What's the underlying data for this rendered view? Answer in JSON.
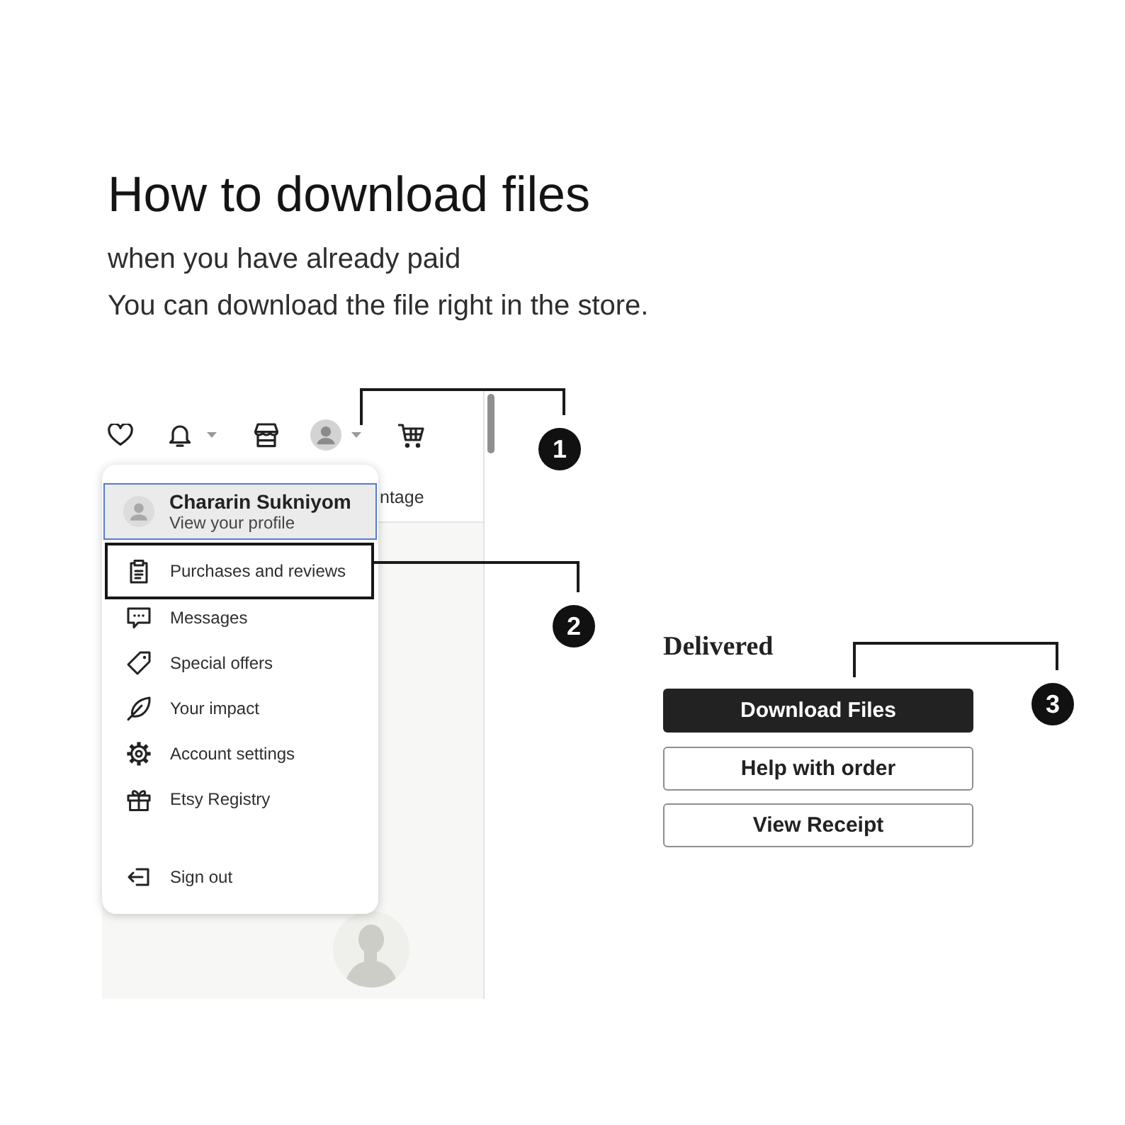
{
  "heading": {
    "title": "How to download files",
    "lines": [
      "when you have already paid",
      "You can download the file right in the store."
    ]
  },
  "store_screenshot": {
    "tab_label": "ntage",
    "account_menu": {
      "sections": [
        {
          "items": [
            {
              "kind": "profile",
              "label": "Chararin Sukniyom",
              "sublabel": "View your profile",
              "selected": true,
              "highlighted": false
            },
            {
              "kind": "link",
              "label": "Purchases and reviews",
              "selected": false,
              "highlighted": true
            },
            {
              "kind": "link",
              "label": "Messages",
              "selected": false,
              "highlighted": false
            },
            {
              "kind": "link",
              "label": "Special offers",
              "selected": false,
              "highlighted": false
            },
            {
              "kind": "link",
              "label": "Your impact",
              "selected": false,
              "highlighted": false
            },
            {
              "kind": "link",
              "label": "Account settings",
              "selected": false,
              "highlighted": false
            },
            {
              "kind": "link",
              "label": "Etsy Registry",
              "selected": false,
              "highlighted": false
            }
          ]
        },
        {
          "items": [
            {
              "kind": "link",
              "label": "Sign out",
              "selected": false,
              "highlighted": false
            }
          ]
        }
      ]
    }
  },
  "order": {
    "status": "Delivered",
    "buttons": [
      {
        "label": "Download Files",
        "primary": true
      },
      {
        "label": "Help with order",
        "primary": false
      },
      {
        "label": "View Receipt",
        "primary": false
      }
    ]
  },
  "callouts": [
    {
      "number": "1"
    },
    {
      "number": "2"
    },
    {
      "number": "3"
    }
  ]
}
